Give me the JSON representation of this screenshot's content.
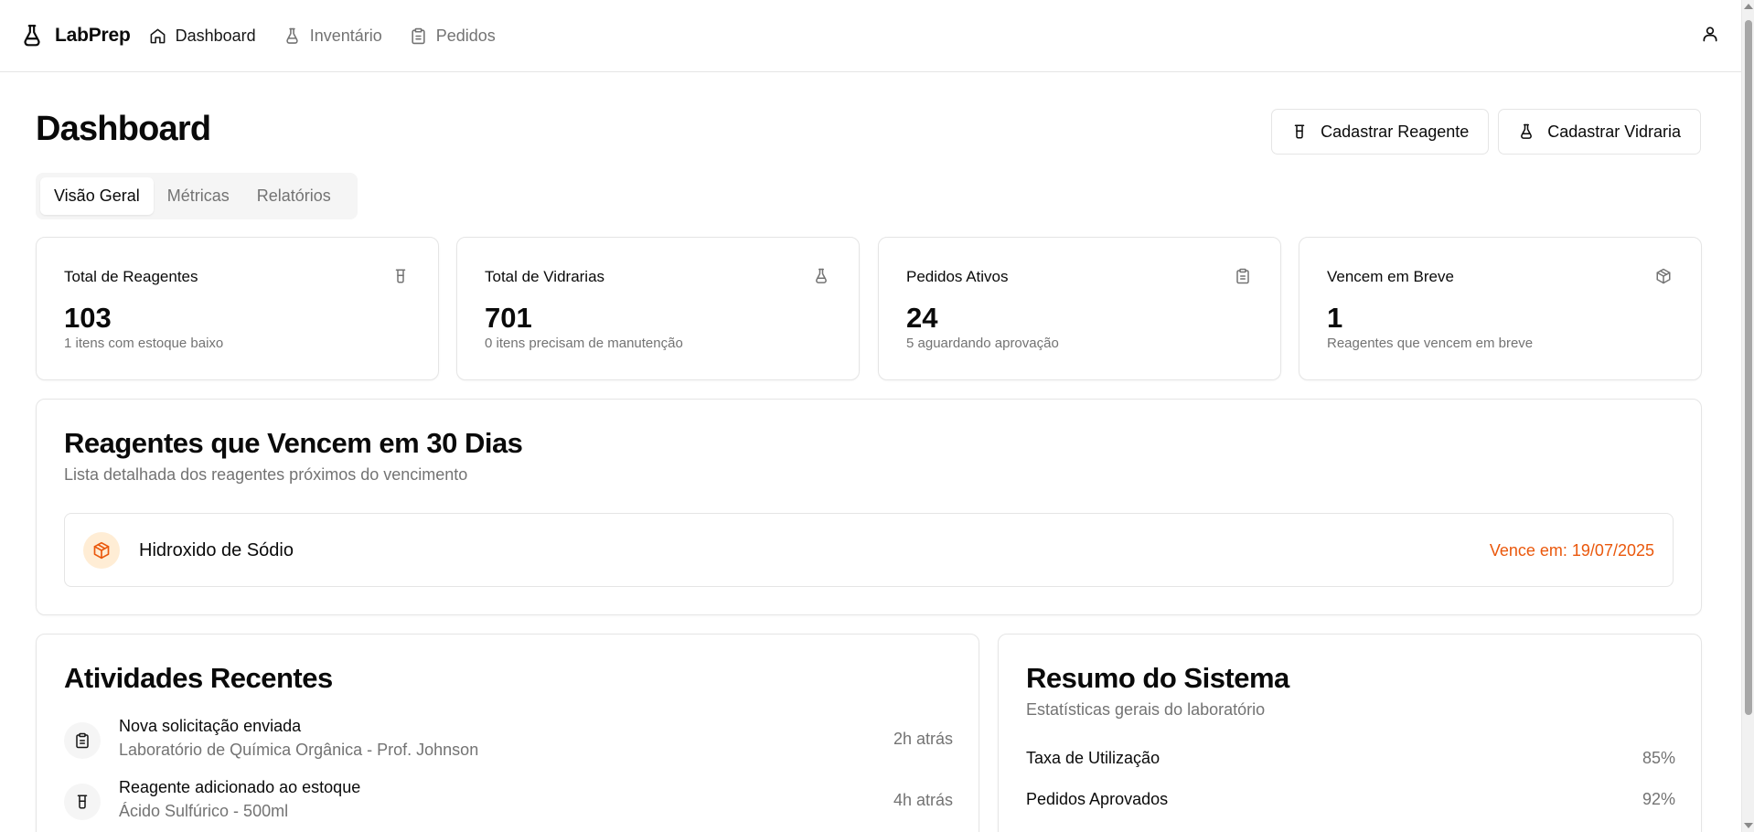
{
  "brand": {
    "name": "LabPrep",
    "icon": "flask-icon"
  },
  "nav": [
    {
      "label": "Dashboard",
      "icon": "home-icon",
      "active": true
    },
    {
      "label": "Inventário",
      "icon": "flask-icon",
      "active": false
    },
    {
      "label": "Pedidos",
      "icon": "clipboard-icon",
      "active": false
    }
  ],
  "header": {
    "title": "Dashboard",
    "register_reagent": "Cadastrar Reagente",
    "register_glassware": "Cadastrar Vidraria"
  },
  "tabs": [
    {
      "label": "Visão Geral",
      "active": true
    },
    {
      "label": "Métricas",
      "active": false
    },
    {
      "label": "Relatórios",
      "active": false
    }
  ],
  "stats": [
    {
      "label": "Total de Reagentes",
      "value": "103",
      "sub": "1 itens com estoque baixo",
      "icon": "beaker-icon"
    },
    {
      "label": "Total de Vidrarias",
      "value": "701",
      "sub": "0 itens precisam de manutenção",
      "icon": "flask-icon"
    },
    {
      "label": "Pedidos Ativos",
      "value": "24",
      "sub": "5 aguardando aprovação",
      "icon": "clipboard-icon"
    },
    {
      "label": "Vencem em Breve",
      "value": "1",
      "sub": "Reagentes que vencem em breve",
      "icon": "package-icon"
    }
  ],
  "expiring": {
    "title": "Reagentes que Vencem em 30 Dias",
    "description": "Lista detalhada dos reagentes próximos do vencimento",
    "items": [
      {
        "name": "Hidroxido de Sódio",
        "expires": "Vence em: 19/07/2025",
        "icon": "package-icon"
      }
    ]
  },
  "activities": {
    "title": "Atividades Recentes",
    "items": [
      {
        "title": "Nova solicitação enviada",
        "subtitle": "Laboratório de Química Orgânica - Prof. Johnson",
        "time": "2h atrás",
        "icon": "clipboard-icon"
      },
      {
        "title": "Reagente adicionado ao estoque",
        "subtitle": "Ácido Sulfúrico - 500ml",
        "time": "4h atrás",
        "icon": "beaker-icon"
      }
    ]
  },
  "summary": {
    "title": "Resumo do Sistema",
    "description": "Estatísticas gerais do laboratório",
    "rows": [
      {
        "label": "Taxa de Utilização",
        "value": "85%"
      },
      {
        "label": "Pedidos Aprovados",
        "value": "92%"
      }
    ]
  },
  "colors": {
    "accent_warning": "#ea580c",
    "warning_bg": "#ffedd5",
    "muted": "#737373",
    "border": "#e5e5e5"
  }
}
